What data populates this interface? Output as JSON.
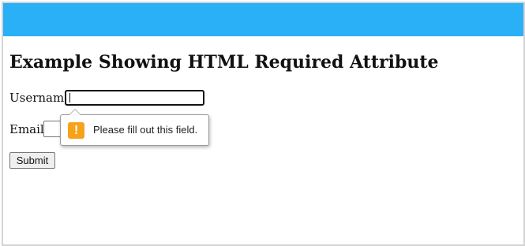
{
  "page": {
    "heading": "Example Showing HTML Required Attribute",
    "banner_color": "#29b0f7"
  },
  "form": {
    "username_label": "Username",
    "username_value": "",
    "email_label": "Email",
    "email_value": "",
    "submit_label": "Submit"
  },
  "validation_tooltip": {
    "icon": "warning-icon",
    "icon_glyph": "!",
    "icon_color": "#f7a21b",
    "message": "Please fill out this field."
  }
}
